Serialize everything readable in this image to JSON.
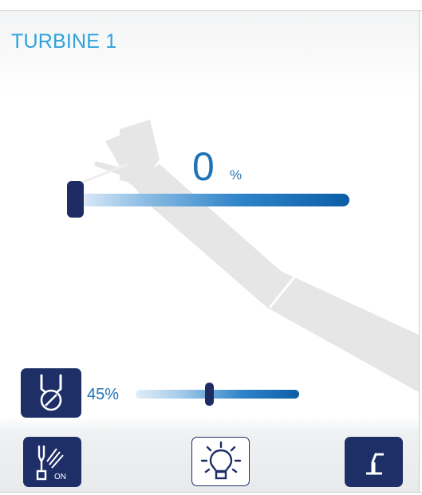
{
  "header": {
    "title": "TURBINE 1"
  },
  "speed": {
    "value": "0",
    "unit": "%",
    "level": 0
  },
  "spray": {
    "value": "45%",
    "level": 0.45
  },
  "footer": {
    "fiber_on_text": "ON"
  },
  "icons": {
    "spray": "spray-water-icon",
    "fiber_optic": "fiber-optic-on-icon",
    "light": "light-bulb-icon",
    "pedal": "foot-pedal-icon"
  },
  "colors": {
    "accent": "#2ea3db",
    "value_text": "#1f73b7",
    "button_dark": "#1e2f68",
    "thumb": "#1e2c63",
    "handpiece": "#e6e6e6"
  }
}
